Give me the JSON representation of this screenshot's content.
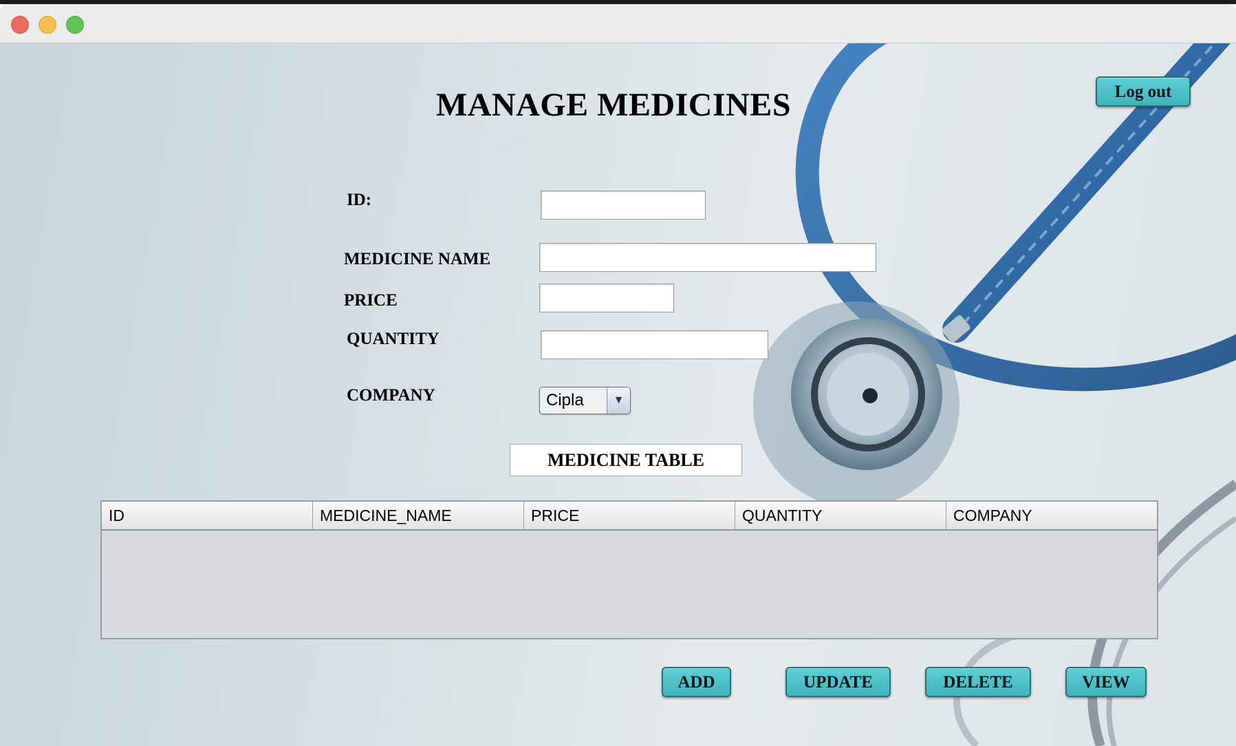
{
  "window": {
    "controls": [
      "close",
      "minimize",
      "maximize"
    ]
  },
  "page": {
    "title": "MANAGE MEDICINES",
    "logout_label": "Log out"
  },
  "form": {
    "id_label": "ID:",
    "name_label": "MEDICINE NAME",
    "price_label": "PRICE",
    "quantity_label": "QUANTITY",
    "company_label": "COMPANY",
    "id_value": "",
    "name_value": "",
    "price_value": "",
    "quantity_value": "",
    "company_selected": "Cipla"
  },
  "table": {
    "caption": "MEDICINE TABLE",
    "columns": [
      "ID",
      "MEDICINE_NAME",
      "PRICE",
      "QUANTITY",
      "COMPANY"
    ],
    "rows": []
  },
  "actions": {
    "add": "ADD",
    "update": "UPDATE",
    "delete": "DELETE",
    "view": "VIEW"
  },
  "colors": {
    "button_fill": "#4cc3c9",
    "background": "#d7e0e4",
    "stethoscope_tube": "#2f6aa3"
  },
  "icons": {
    "combo_arrow": "chevron-down-icon"
  }
}
